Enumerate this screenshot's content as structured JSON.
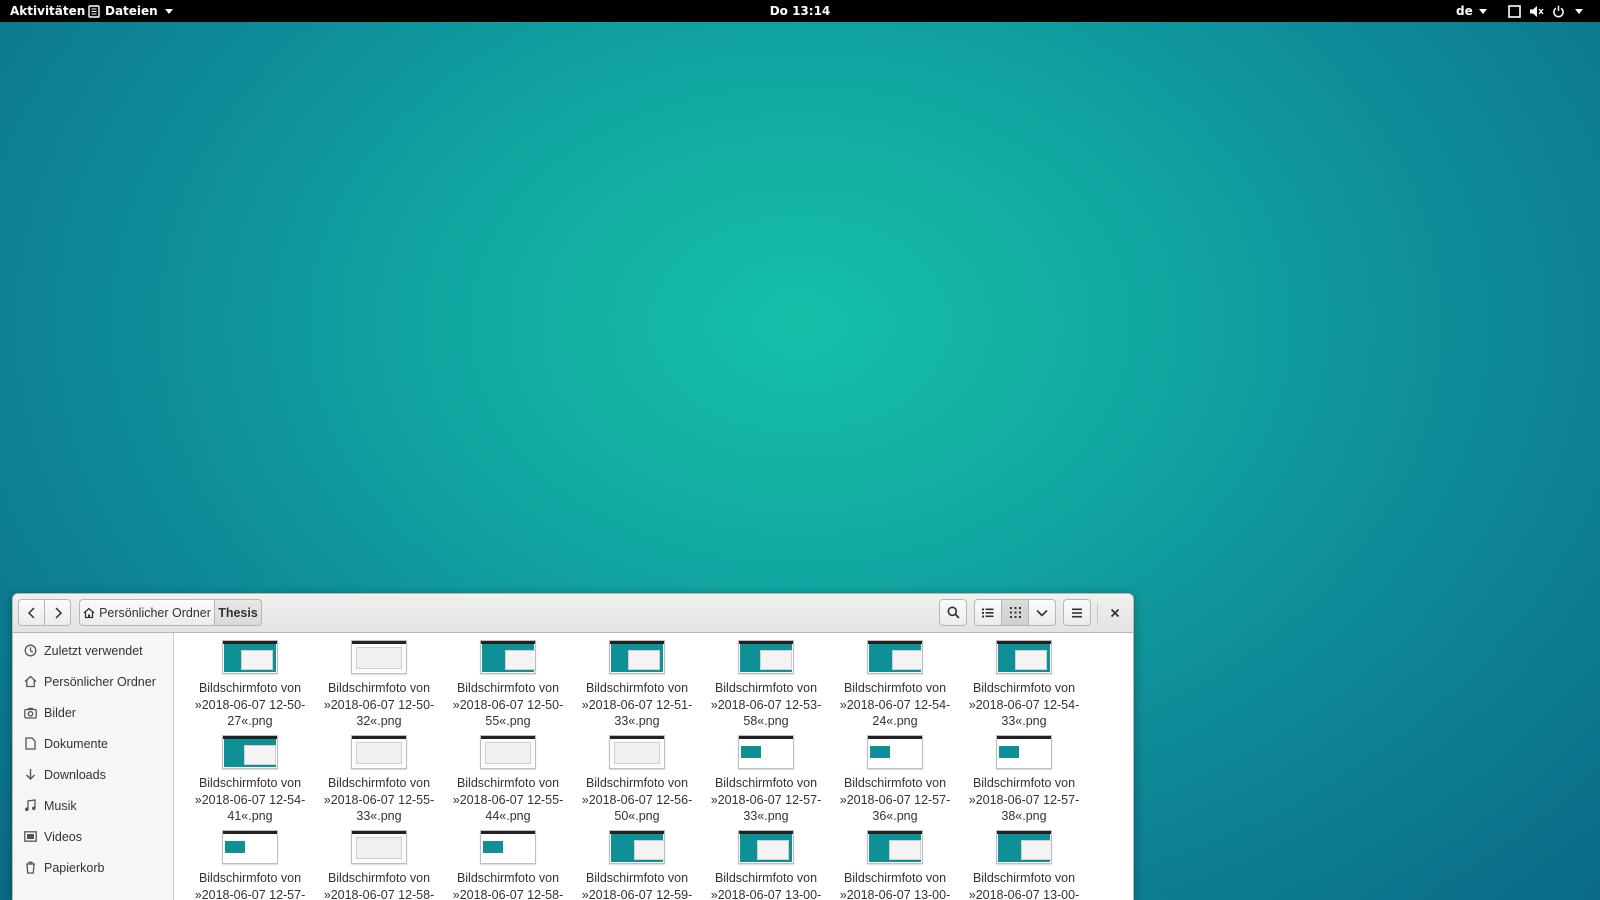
{
  "topbar": {
    "activities": "Aktivitäten",
    "app_name": "Dateien",
    "clock": "Do 13:14",
    "lang": "de",
    "status_icons": [
      "window-icon",
      "volume-muted-icon",
      "power-icon"
    ]
  },
  "window": {
    "breadcrumb": {
      "home": "Persönlicher Ordner",
      "current": "Thesis"
    },
    "toolbar_icons": [
      "search-icon",
      "list-view-icon",
      "grid-view-icon",
      "chevron-down-icon",
      "hamburger-menu-icon",
      "close-icon"
    ],
    "sidebar": [
      {
        "label": "Zuletzt verwendet",
        "icon": "clock-icon"
      },
      {
        "label": "Persönlicher Ordner",
        "icon": "home-icon"
      },
      {
        "label": "Bilder",
        "icon": "camera-icon"
      },
      {
        "label": "Dokumente",
        "icon": "document-icon"
      },
      {
        "label": "Downloads",
        "icon": "download-icon"
      },
      {
        "label": "Musik",
        "icon": "music-icon"
      },
      {
        "label": "Videos",
        "icon": "video-icon"
      },
      {
        "label": "Papierkorb",
        "icon": "trash-icon"
      }
    ],
    "files": [
      {
        "l1": "Bildschirmfoto von",
        "l2": "»2018-06-07 12-50-",
        "l3": "27«.png",
        "thumb": "teal"
      },
      {
        "l1": "Bildschirmfoto von",
        "l2": "»2018-06-07 12-50-",
        "l3": "32«.png",
        "thumb": "white"
      },
      {
        "l1": "Bildschirmfoto von",
        "l2": "»2018-06-07 12-50-",
        "l3": "55«.png",
        "thumb": "teal"
      },
      {
        "l1": "Bildschirmfoto von",
        "l2": "»2018-06-07 12-51-",
        "l3": "33«.png",
        "thumb": "teal"
      },
      {
        "l1": "Bildschirmfoto von",
        "l2": "»2018-06-07 12-53-",
        "l3": "58«.png",
        "thumb": "teal"
      },
      {
        "l1": "Bildschirmfoto von",
        "l2": "»2018-06-07 12-54-",
        "l3": "24«.png",
        "thumb": "teal"
      },
      {
        "l1": "Bildschirmfoto von",
        "l2": "»2018-06-07 12-54-",
        "l3": "33«.png",
        "thumb": "teal"
      },
      {
        "l1": "Bildschirmfoto von",
        "l2": "»2018-06-07 12-54-",
        "l3": "41«.png",
        "thumb": "teal"
      },
      {
        "l1": "Bildschirmfoto von",
        "l2": "»2018-06-07 12-55-",
        "l3": "33«.png",
        "thumb": "white"
      },
      {
        "l1": "Bildschirmfoto von",
        "l2": "»2018-06-07 12-55-",
        "l3": "44«.png",
        "thumb": "white"
      },
      {
        "l1": "Bildschirmfoto von",
        "l2": "»2018-06-07 12-56-",
        "l3": "50«.png",
        "thumb": "white"
      },
      {
        "l1": "Bildschirmfoto von",
        "l2": "»2018-06-07 12-57-",
        "l3": "33«.png",
        "thumb": "mixed"
      },
      {
        "l1": "Bildschirmfoto von",
        "l2": "»2018-06-07 12-57-",
        "l3": "36«.png",
        "thumb": "mixed"
      },
      {
        "l1": "Bildschirmfoto von",
        "l2": "»2018-06-07 12-57-",
        "l3": "38«.png",
        "thumb": "mixed"
      },
      {
        "l1": "Bildschirmfoto von",
        "l2": "»2018-06-07 12-57-",
        "l3": "",
        "thumb": "mixed"
      },
      {
        "l1": "Bildschirmfoto von",
        "l2": "»2018-06-07 12-58-",
        "l3": "",
        "thumb": "white"
      },
      {
        "l1": "Bildschirmfoto von",
        "l2": "»2018-06-07 12-58-",
        "l3": "",
        "thumb": "mixed"
      },
      {
        "l1": "Bildschirmfoto von",
        "l2": "»2018-06-07 12-59-",
        "l3": "",
        "thumb": "teal"
      },
      {
        "l1": "Bildschirmfoto von",
        "l2": "»2018-06-07 13-00-",
        "l3": "",
        "thumb": "teal"
      },
      {
        "l1": "Bildschirmfoto von",
        "l2": "»2018-06-07 13-00-",
        "l3": "",
        "thumb": "teal"
      },
      {
        "l1": "Bildschirmfoto von",
        "l2": "»2018-06-07 13-00-",
        "l3": "",
        "thumb": "teal"
      }
    ]
  },
  "colors": {
    "desktop": "#12a8a2",
    "thumb_teal": "#0f8f96",
    "topbar": "#000000"
  }
}
